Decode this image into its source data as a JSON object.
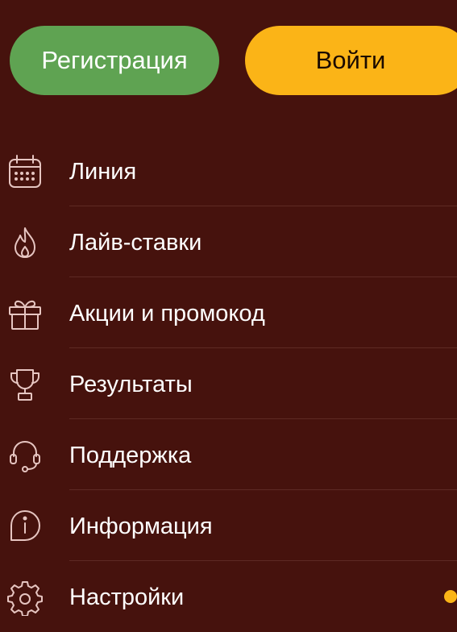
{
  "auth": {
    "register_label": "Регистрация",
    "login_label": "Войти"
  },
  "menu": {
    "items": [
      {
        "label": "Линия",
        "icon": "calendar-icon"
      },
      {
        "label": "Лайв-ставки",
        "icon": "flame-icon"
      },
      {
        "label": "Акции и промокод",
        "icon": "gift-icon"
      },
      {
        "label": "Результаты",
        "icon": "trophy-icon"
      },
      {
        "label": "Поддержка",
        "icon": "headset-icon"
      },
      {
        "label": "Информация",
        "icon": "info-icon"
      },
      {
        "label": "Настройки",
        "icon": "gear-icon"
      }
    ]
  },
  "colors": {
    "background": "#46120d",
    "register_button": "#5fa352",
    "login_button": "#fbb417",
    "icon_stroke": "#e6c5c1",
    "divider": "#5e2a24",
    "notification_dot": "#fbb417"
  }
}
